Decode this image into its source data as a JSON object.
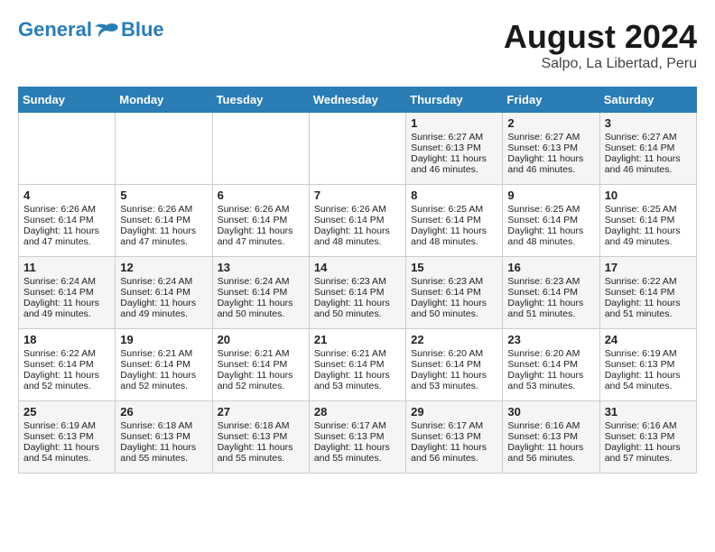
{
  "header": {
    "logo_line1": "General",
    "logo_line2": "Blue",
    "month_year": "August 2024",
    "location": "Salpo, La Libertad, Peru"
  },
  "days_of_week": [
    "Sunday",
    "Monday",
    "Tuesday",
    "Wednesday",
    "Thursday",
    "Friday",
    "Saturday"
  ],
  "weeks": [
    [
      {
        "day": "",
        "info": ""
      },
      {
        "day": "",
        "info": ""
      },
      {
        "day": "",
        "info": ""
      },
      {
        "day": "",
        "info": ""
      },
      {
        "day": "1",
        "info": "Sunrise: 6:27 AM\nSunset: 6:13 PM\nDaylight: 11 hours\nand 46 minutes."
      },
      {
        "day": "2",
        "info": "Sunrise: 6:27 AM\nSunset: 6:13 PM\nDaylight: 11 hours\nand 46 minutes."
      },
      {
        "day": "3",
        "info": "Sunrise: 6:27 AM\nSunset: 6:14 PM\nDaylight: 11 hours\nand 46 minutes."
      }
    ],
    [
      {
        "day": "4",
        "info": "Sunrise: 6:26 AM\nSunset: 6:14 PM\nDaylight: 11 hours\nand 47 minutes."
      },
      {
        "day": "5",
        "info": "Sunrise: 6:26 AM\nSunset: 6:14 PM\nDaylight: 11 hours\nand 47 minutes."
      },
      {
        "day": "6",
        "info": "Sunrise: 6:26 AM\nSunset: 6:14 PM\nDaylight: 11 hours\nand 47 minutes."
      },
      {
        "day": "7",
        "info": "Sunrise: 6:26 AM\nSunset: 6:14 PM\nDaylight: 11 hours\nand 48 minutes."
      },
      {
        "day": "8",
        "info": "Sunrise: 6:25 AM\nSunset: 6:14 PM\nDaylight: 11 hours\nand 48 minutes."
      },
      {
        "day": "9",
        "info": "Sunrise: 6:25 AM\nSunset: 6:14 PM\nDaylight: 11 hours\nand 48 minutes."
      },
      {
        "day": "10",
        "info": "Sunrise: 6:25 AM\nSunset: 6:14 PM\nDaylight: 11 hours\nand 49 minutes."
      }
    ],
    [
      {
        "day": "11",
        "info": "Sunrise: 6:24 AM\nSunset: 6:14 PM\nDaylight: 11 hours\nand 49 minutes."
      },
      {
        "day": "12",
        "info": "Sunrise: 6:24 AM\nSunset: 6:14 PM\nDaylight: 11 hours\nand 49 minutes."
      },
      {
        "day": "13",
        "info": "Sunrise: 6:24 AM\nSunset: 6:14 PM\nDaylight: 11 hours\nand 50 minutes."
      },
      {
        "day": "14",
        "info": "Sunrise: 6:23 AM\nSunset: 6:14 PM\nDaylight: 11 hours\nand 50 minutes."
      },
      {
        "day": "15",
        "info": "Sunrise: 6:23 AM\nSunset: 6:14 PM\nDaylight: 11 hours\nand 50 minutes."
      },
      {
        "day": "16",
        "info": "Sunrise: 6:23 AM\nSunset: 6:14 PM\nDaylight: 11 hours\nand 51 minutes."
      },
      {
        "day": "17",
        "info": "Sunrise: 6:22 AM\nSunset: 6:14 PM\nDaylight: 11 hours\nand 51 minutes."
      }
    ],
    [
      {
        "day": "18",
        "info": "Sunrise: 6:22 AM\nSunset: 6:14 PM\nDaylight: 11 hours\nand 52 minutes."
      },
      {
        "day": "19",
        "info": "Sunrise: 6:21 AM\nSunset: 6:14 PM\nDaylight: 11 hours\nand 52 minutes."
      },
      {
        "day": "20",
        "info": "Sunrise: 6:21 AM\nSunset: 6:14 PM\nDaylight: 11 hours\nand 52 minutes."
      },
      {
        "day": "21",
        "info": "Sunrise: 6:21 AM\nSunset: 6:14 PM\nDaylight: 11 hours\nand 53 minutes."
      },
      {
        "day": "22",
        "info": "Sunrise: 6:20 AM\nSunset: 6:14 PM\nDaylight: 11 hours\nand 53 minutes."
      },
      {
        "day": "23",
        "info": "Sunrise: 6:20 AM\nSunset: 6:14 PM\nDaylight: 11 hours\nand 53 minutes."
      },
      {
        "day": "24",
        "info": "Sunrise: 6:19 AM\nSunset: 6:13 PM\nDaylight: 11 hours\nand 54 minutes."
      }
    ],
    [
      {
        "day": "25",
        "info": "Sunrise: 6:19 AM\nSunset: 6:13 PM\nDaylight: 11 hours\nand 54 minutes."
      },
      {
        "day": "26",
        "info": "Sunrise: 6:18 AM\nSunset: 6:13 PM\nDaylight: 11 hours\nand 55 minutes."
      },
      {
        "day": "27",
        "info": "Sunrise: 6:18 AM\nSunset: 6:13 PM\nDaylight: 11 hours\nand 55 minutes."
      },
      {
        "day": "28",
        "info": "Sunrise: 6:17 AM\nSunset: 6:13 PM\nDaylight: 11 hours\nand 55 minutes."
      },
      {
        "day": "29",
        "info": "Sunrise: 6:17 AM\nSunset: 6:13 PM\nDaylight: 11 hours\nand 56 minutes."
      },
      {
        "day": "30",
        "info": "Sunrise: 6:16 AM\nSunset: 6:13 PM\nDaylight: 11 hours\nand 56 minutes."
      },
      {
        "day": "31",
        "info": "Sunrise: 6:16 AM\nSunset: 6:13 PM\nDaylight: 11 hours\nand 57 minutes."
      }
    ]
  ]
}
